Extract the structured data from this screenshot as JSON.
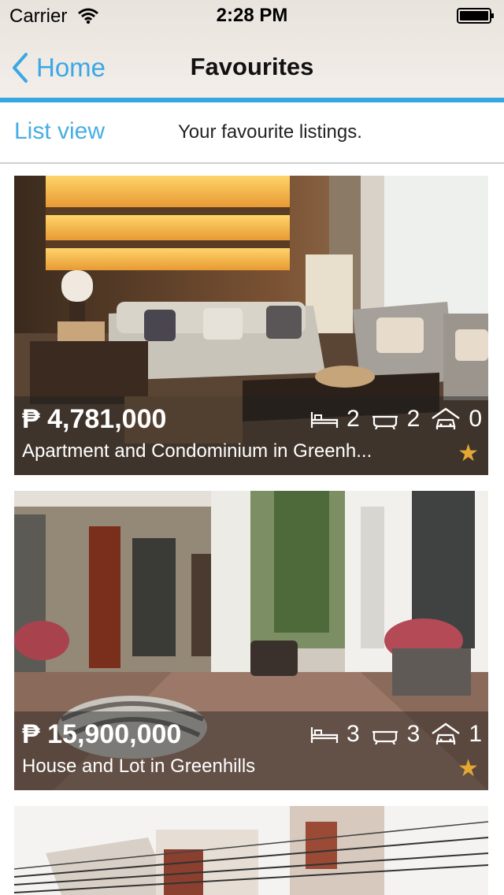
{
  "status_bar": {
    "carrier": "Carrier",
    "time": "2:28 PM"
  },
  "nav": {
    "back_label": "Home",
    "title": "Favourites"
  },
  "subheader": {
    "list_view": "List view",
    "subtitle": "Your favourite listings."
  },
  "listings": [
    {
      "price": "₱ 4,781,000",
      "title": "Apartment and Condominium in Greenh...",
      "bedrooms": "2",
      "bathrooms": "2",
      "parking": "0",
      "favourite": true
    },
    {
      "price": "₱ 15,900,000",
      "title": "House and Lot in Greenhills",
      "bedrooms": "3",
      "bathrooms": "3",
      "parking": "1",
      "favourite": true
    }
  ],
  "colors": {
    "accent": "#37a7e1",
    "link": "#3aa8e4",
    "star": "#e3a833"
  },
  "icons": [
    "wifi-icon",
    "battery-icon",
    "chevron-left-icon",
    "bed-icon",
    "bathtub-icon",
    "garage-icon",
    "star-icon"
  ]
}
